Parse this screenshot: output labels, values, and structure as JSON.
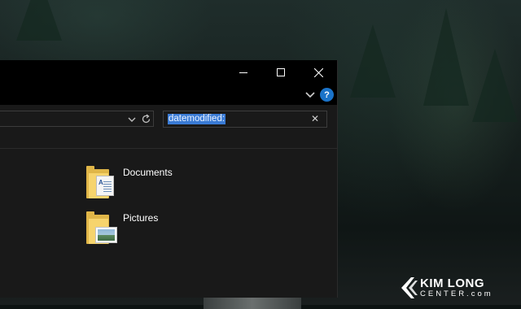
{
  "window": {
    "controls": {
      "minimize_icon": "minimize-icon",
      "maximize_icon": "maximize-icon",
      "close_icon": "close-icon"
    },
    "help_label": "?"
  },
  "search": {
    "value": "datemodified:",
    "clear_label": "✕"
  },
  "items": [
    {
      "name": "Documents",
      "icon": "documents-folder-icon"
    },
    {
      "name": "Pictures",
      "icon": "pictures-folder-icon"
    }
  ],
  "watermark": {
    "top": "KIM LONG",
    "bottom": "CENTER.com"
  },
  "colors": {
    "accent": "#1a73c9",
    "selection": "#3a7bd5",
    "folder": "#f6d46d",
    "window_bg": "#191919",
    "titlebar_bg": "#000000"
  }
}
